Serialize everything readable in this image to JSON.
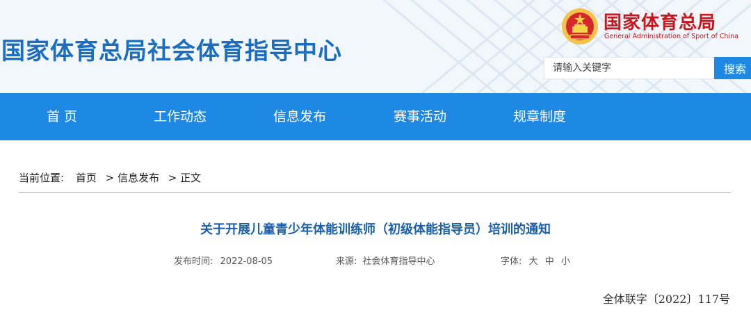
{
  "header": {
    "site_title": "国家体育总局社会体育指导中心",
    "logo_cn": "国家体育总局",
    "logo_en": "General Administration of Sport of China",
    "search_placeholder": "请输入关键字",
    "search_button": "搜索",
    "brand_color": "#1e88e5",
    "logo_color": "#c8161d"
  },
  "nav": {
    "items": [
      {
        "label": "首 页"
      },
      {
        "label": "工作动态"
      },
      {
        "label": "信息发布"
      },
      {
        "label": "赛事活动"
      },
      {
        "label": "规章制度"
      }
    ]
  },
  "breadcrumb": {
    "prefix": "当前位置:",
    "home": "首页",
    "sep1": ">",
    "section": "信息发布",
    "sep2": ">",
    "current": "正文"
  },
  "article": {
    "title": "关于开展儿童青少年体能训练师（初级体能指导员）培训的通知",
    "publish_label": "发布时间:",
    "publish_date": "2022-08-05",
    "source_label": "来源:",
    "source": "社会体育指导中心",
    "font_label": "字体:",
    "font_large": "大",
    "font_medium": "中",
    "font_small": "小",
    "doc_number": "全体联字〔2022〕117号"
  }
}
